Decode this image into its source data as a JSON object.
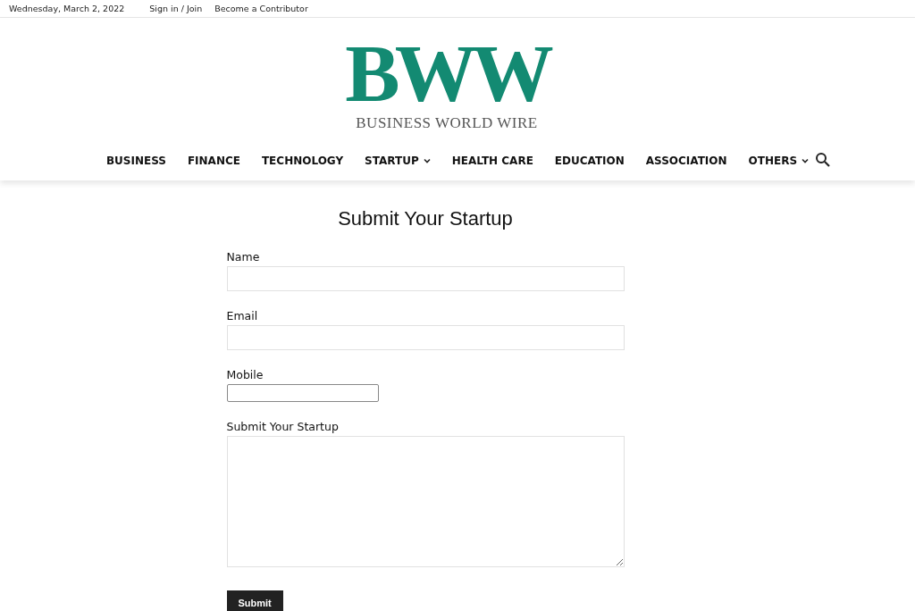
{
  "top_bar": {
    "date": "Wednesday, March 2, 2022",
    "links": [
      "Sign in / Join",
      "Become a Contributor"
    ]
  },
  "logo": {
    "mark": "BWW",
    "name": "BUSINESS WORLD WIRE"
  },
  "nav": {
    "items": [
      {
        "label": "BUSINESS",
        "dropdown": false
      },
      {
        "label": "FINANCE",
        "dropdown": false
      },
      {
        "label": "TECHNOLOGY",
        "dropdown": false
      },
      {
        "label": "STARTUP",
        "dropdown": true
      },
      {
        "label": "HEALTH CARE",
        "dropdown": false
      },
      {
        "label": "EDUCATION",
        "dropdown": false
      },
      {
        "label": "ASSOCIATION",
        "dropdown": false
      },
      {
        "label": "OTHERS",
        "dropdown": true
      }
    ]
  },
  "form": {
    "title": "Submit Your Startup",
    "fields": [
      {
        "label": "Name",
        "kind": "text"
      },
      {
        "label": "Email",
        "kind": "text"
      },
      {
        "label": "Mobile",
        "kind": "short"
      },
      {
        "label": "Submit Your Startup",
        "kind": "textarea"
      }
    ],
    "submit": "Submit"
  }
}
